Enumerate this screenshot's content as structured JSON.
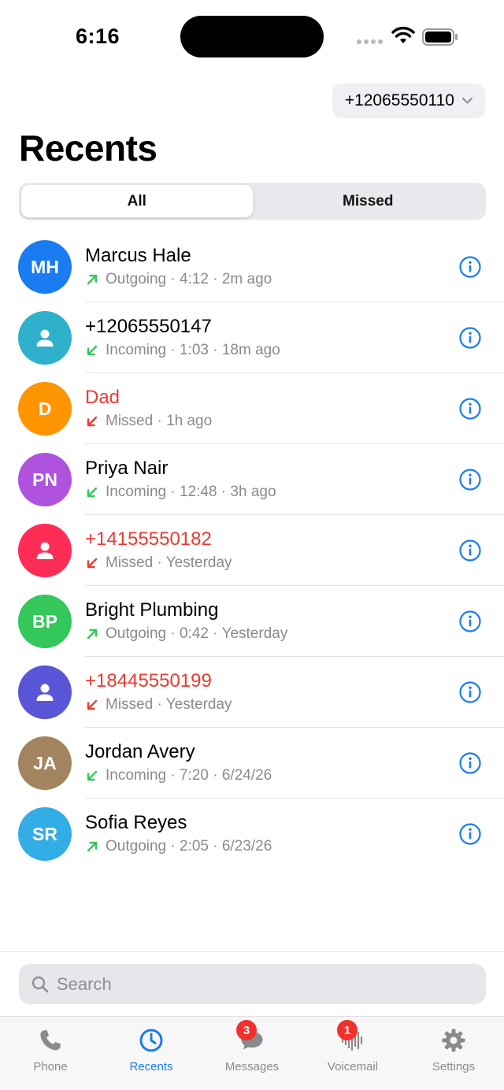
{
  "status_bar": {
    "time": "6:16"
  },
  "header": {
    "selected_number": "+12065550110",
    "title": "Recents"
  },
  "segments": [
    {
      "label": "All",
      "active": true
    },
    {
      "label": "Missed",
      "active": false
    }
  ],
  "calls": [
    {
      "initials": "MH",
      "avatar_color": "#1a7cf0",
      "name": "Marcus Hale",
      "missed": false,
      "direction": "outgoing",
      "detail": "Outgoing · 4:12 · 2m ago"
    },
    {
      "initials": "",
      "avatar_color": "#2fb1cb",
      "name": "+12065550147",
      "missed": false,
      "direction": "incoming",
      "detail": "Incoming · 1:03 · 18m ago"
    },
    {
      "initials": "D",
      "avatar_color": "#ff9500",
      "name": "Dad",
      "missed": true,
      "direction": "missed",
      "detail": "Missed · 1h ago"
    },
    {
      "initials": "PN",
      "avatar_color": "#af52de",
      "name": "Priya Nair",
      "missed": false,
      "direction": "incoming",
      "detail": "Incoming · 12:48 · 3h ago"
    },
    {
      "initials": "",
      "avatar_color": "#ff2d55",
      "name": "+14155550182",
      "missed": true,
      "direction": "missed",
      "detail": "Missed · Yesterday"
    },
    {
      "initials": "BP",
      "avatar_color": "#34c759",
      "name": "Bright Plumbing",
      "missed": false,
      "direction": "outgoing",
      "detail": "Outgoing · 0:42 · Yesterday"
    },
    {
      "initials": "",
      "avatar_color": "#5856d6",
      "name": "+18445550199",
      "missed": true,
      "direction": "missed",
      "detail": "Missed · Yesterday"
    },
    {
      "initials": "JA",
      "avatar_color": "#a2845e",
      "name": "Jordan Avery",
      "missed": false,
      "direction": "incoming",
      "detail": "Incoming · 7:20 · 6/24/26"
    },
    {
      "initials": "SR",
      "avatar_color": "#32ade6",
      "name": "Sofia Reyes",
      "missed": false,
      "direction": "outgoing",
      "detail": "Outgoing · 2:05 · 6/23/26"
    }
  ],
  "search": {
    "placeholder": "Search"
  },
  "tabs": [
    {
      "label": "Phone",
      "icon": "phone-icon",
      "active": false,
      "badge": ""
    },
    {
      "label": "Recents",
      "icon": "clock-icon",
      "active": true,
      "badge": ""
    },
    {
      "label": "Messages",
      "icon": "message-bubble-icon",
      "active": false,
      "badge": "3"
    },
    {
      "label": "Voicemail",
      "icon": "voicemail-waveform-icon",
      "active": false,
      "badge": "1"
    },
    {
      "label": "Settings",
      "icon": "gear-icon",
      "active": false,
      "badge": ""
    }
  ],
  "colors": {
    "accent": "#1a7cf0",
    "missed": "#ee3a31",
    "answered_arrow": "#34c759",
    "secondary_text": "#8a8a8e"
  }
}
